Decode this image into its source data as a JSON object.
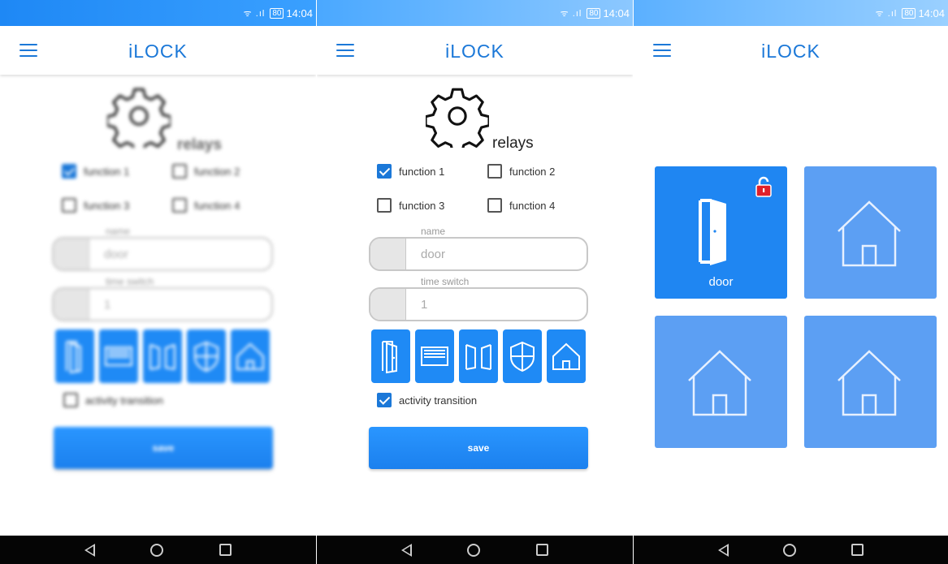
{
  "status": {
    "signal": "ᯤ .ıl",
    "battery": "80",
    "time": "14:04"
  },
  "app": {
    "title": "iLOCK"
  },
  "settings": {
    "section_label": "relays",
    "functions": [
      {
        "label": "function 1",
        "checked": true
      },
      {
        "label": "function 2",
        "checked": false
      },
      {
        "label": "function 3",
        "checked": false
      },
      {
        "label": "function 4",
        "checked": false
      }
    ],
    "name_label": "name",
    "name_value": "door",
    "time_label": "time switch",
    "time_value": "1",
    "relay_icons": [
      "door-icon",
      "garage-door-icon",
      "gate-icon",
      "shield-icon",
      "house-icon"
    ],
    "activity_label": "activity transition",
    "save_label": "save"
  },
  "screen1": {
    "activity_checked": false
  },
  "screen2": {
    "activity_checked": true
  },
  "grid": {
    "tiles": [
      {
        "label": "door",
        "icon": "door-icon",
        "locked": true
      },
      {
        "label": "",
        "icon": "house-icon"
      },
      {
        "label": "",
        "icon": "house-icon"
      },
      {
        "label": "",
        "icon": "house-icon"
      }
    ]
  },
  "colors": {
    "accent": "#1b78d8",
    "tile": "#5c9ff3",
    "tile_active": "#1f86f2",
    "lock": "#e0202a"
  }
}
